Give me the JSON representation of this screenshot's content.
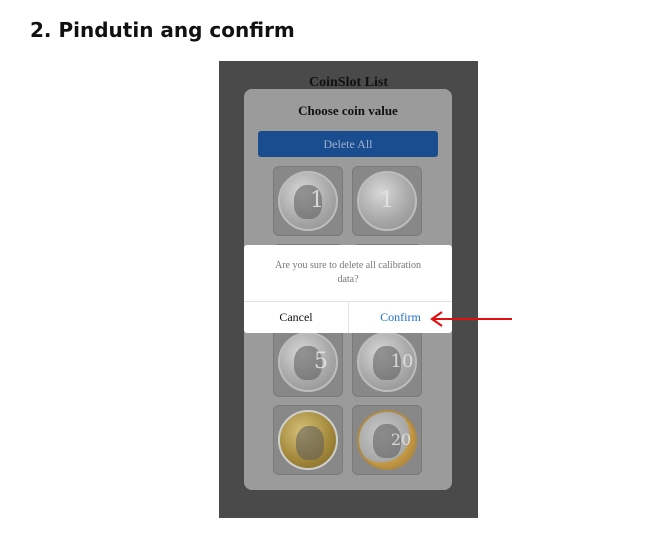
{
  "instruction": {
    "title": "2. Pindutin ang confirm"
  },
  "app": {
    "title": "CoinSlot List"
  },
  "sheet": {
    "title": "Choose coin value",
    "delete_all_label": "Delete All"
  },
  "coins": [
    {
      "label": "1",
      "type": "silver"
    },
    {
      "label": "1",
      "type": "silver"
    },
    {
      "label": "5",
      "type": "silver"
    },
    {
      "label": "10",
      "type": "silver"
    },
    {
      "label": "",
      "type": "gold"
    },
    {
      "label": "20",
      "type": "bimetal"
    }
  ],
  "dialog": {
    "message": "Are you sure to delete all calibration data?",
    "cancel_label": "Cancel",
    "confirm_label": "Confirm"
  },
  "colors": {
    "confirm": "#1f6fd1",
    "arrow": "#e01010",
    "delete_button": "#1a4d8f",
    "overlay": "#4a4a4a"
  },
  "icons": {
    "pointer": "red-arrow-left-icon"
  }
}
